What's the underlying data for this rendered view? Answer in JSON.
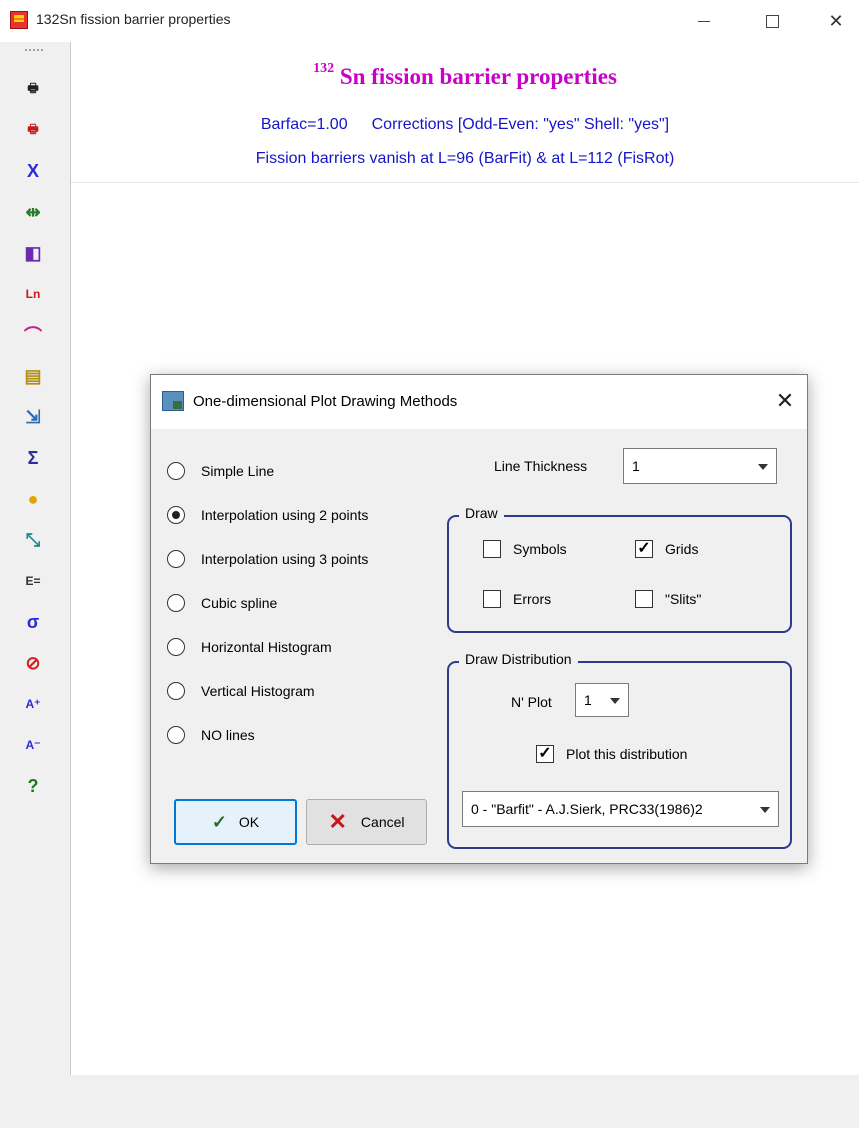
{
  "window": {
    "title": "132Sn fission barrier properties",
    "min_glyph": "—",
    "max_glyph": "☐",
    "close_glyph": "✕"
  },
  "toolbar": {
    "buttons": [
      {
        "name": "print-icon",
        "glyph": "🖶",
        "color": "#1f1f1f"
      },
      {
        "name": "print-color-icon",
        "glyph": "🖶",
        "color": "#c41c1c"
      },
      {
        "name": "x-axis-icon",
        "glyph": "X",
        "color": "#2b2bd6"
      },
      {
        "name": "scatter-scale-icon",
        "glyph": "⇹",
        "color": "#2b7a2b"
      },
      {
        "name": "color-palette-icon",
        "glyph": "◧",
        "color": "#6a2bb0"
      },
      {
        "name": "log-scale-icon",
        "glyph": "Ln",
        "color": "#c81c1c"
      },
      {
        "name": "curve-icon",
        "glyph": "⌒",
        "color": "#c8218a"
      },
      {
        "name": "value-table-icon",
        "glyph": "▤",
        "color": "#b09010"
      },
      {
        "name": "export-data-icon",
        "glyph": "⇲",
        "color": "#2b6ab0"
      },
      {
        "name": "statistics-icon",
        "glyph": "Σ",
        "color": "#2b2b9a"
      },
      {
        "name": "nucleus-icon",
        "glyph": "●",
        "color": "#e3a400"
      },
      {
        "name": "fit-icon",
        "glyph": "⤡",
        "color": "#1c8c8c"
      },
      {
        "name": "formula-icon",
        "glyph": "E=",
        "color": "#333333"
      },
      {
        "name": "sigma-icon",
        "glyph": "σ",
        "color": "#2b2bd6"
      },
      {
        "name": "no-draw-icon",
        "glyph": "⊘",
        "color": "#d02020"
      },
      {
        "name": "font-increase-icon",
        "glyph": "A⁺",
        "color": "#2b2bd6"
      },
      {
        "name": "font-decrease-icon",
        "glyph": "A⁻",
        "color": "#2b2bd6"
      },
      {
        "name": "help-icon",
        "glyph": "?",
        "color": "#1c7a1c"
      }
    ]
  },
  "plot": {
    "title_mass": "132",
    "title_rest": " Sn fission barrier properties",
    "barfac": "Barfac=1.00",
    "corrections": "Corrections [Odd-Even: \"yes\"  Shell: \"yes\"]",
    "vanish": "Fission barriers vanish at L=96 (BarFit) & at L=112 (FisRot)",
    "title_color": "#c800c8",
    "text_color": "#1515c8"
  },
  "dialog": {
    "title": "One-dimensional Plot Drawing Methods",
    "close_glyph": "✕",
    "methods": [
      {
        "label": "Simple Line",
        "checked": false
      },
      {
        "label": "Interpolation using 2 points",
        "checked": true
      },
      {
        "label": "Interpolation using 3 points",
        "checked": false
      },
      {
        "label": "Cubic spline",
        "checked": false
      },
      {
        "label": "Horizontal Histogram",
        "checked": false
      },
      {
        "label": "Vertical Histogram",
        "checked": false
      },
      {
        "label": "NO lines",
        "checked": false
      }
    ],
    "ok_label": "OK",
    "ok_glyph": "✓",
    "cancel_label": "Cancel",
    "cancel_glyph": "✕",
    "line_thickness_label": "Line Thickness",
    "line_thickness_value": "1",
    "draw_group": {
      "title": "Draw",
      "symbols": {
        "label": "Symbols",
        "checked": false
      },
      "grids": {
        "label": "Grids",
        "checked": true
      },
      "errors": {
        "label": "Errors",
        "checked": false
      },
      "slits": {
        "label": "\"Slits\"",
        "checked": false
      }
    },
    "distribution_group": {
      "title": "Draw Distribution",
      "nplot_label": "N' Plot",
      "nplot_value": "1",
      "plot_this": {
        "label": "Plot this distribution",
        "checked": true
      },
      "source_value": "0 - \"Barfit\" - A.J.Sierk, PRC33(1986)2"
    },
    "check_mark": "✓"
  }
}
